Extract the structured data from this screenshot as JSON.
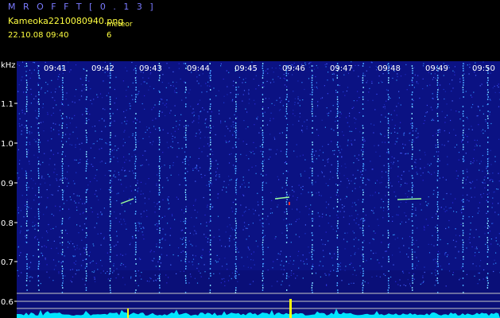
{
  "header": {
    "app_title": "M R O F F T  [ 0 . 1 3 ]",
    "file_name": "Kameoka2210080940.png",
    "meteor_label": "meteor",
    "datetime": "22.10.08 09:40",
    "meteor_count": "6"
  },
  "plot": {
    "y_unit": "kHz",
    "y_ticks": [
      "1.1",
      "1.0",
      "0.9",
      "0.8",
      "0.7",
      "0.6"
    ],
    "time_ticks": [
      "09:41",
      "09:42",
      "09:43",
      "09:44",
      "09:45",
      "09:46",
      "09:47",
      "09:48",
      "09:49",
      "09:50"
    ]
  },
  "colors": {
    "background": "#000000",
    "plot_noise": "#0b0f80",
    "axis_text": "#ffffff",
    "header_title": "#7a7aff",
    "header_text": "#ffff40",
    "signal_trace": "#00e5ff",
    "marker": "#ffff00"
  }
}
